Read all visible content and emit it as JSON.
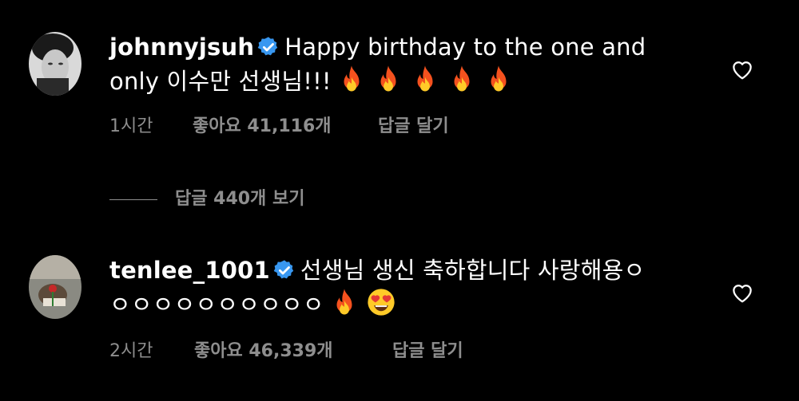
{
  "comments": [
    {
      "username": "johnnyjsuh",
      "text_line1": "Happy birthday to the one and",
      "text_line2": "only 이수만 선생님!!!",
      "emojis_line2": [
        "fire-emoji",
        "fire-emoji",
        "fire-emoji",
        "fire-emoji",
        "fire-emoji"
      ],
      "time": "1시간",
      "likes": "좋아요 41,116개",
      "reply_label": "답글 달기",
      "view_replies": "답글 440개 보기"
    },
    {
      "username": "tenlee_1001",
      "text_line1": "선생님 생신 축하합니다 사랑해용ㅇ",
      "text_line2": "ㅇㅇㅇㅇㅇㅇㅇㅇㅇㅇ",
      "emojis_line2": [
        "fire-emoji",
        "heart-eyes-emoji"
      ],
      "time": "2시간",
      "likes": "좋아요 46,339개",
      "reply_label": "답글 달기"
    }
  ],
  "colors": {
    "background": "#000000",
    "text": "#ffffff",
    "secondary_text": "#8e8e8e",
    "verified_badge": "#3897f0"
  }
}
